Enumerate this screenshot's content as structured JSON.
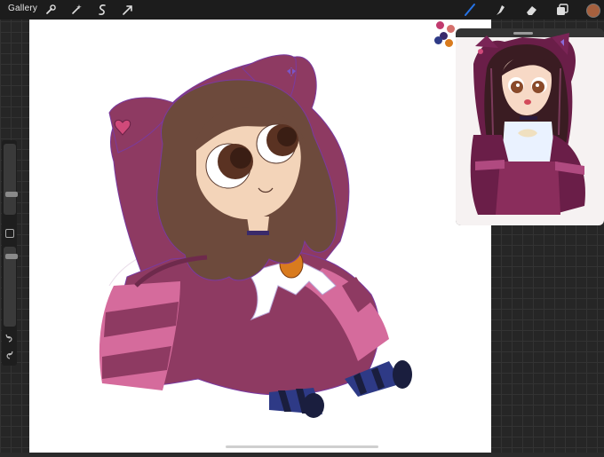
{
  "topbar": {
    "gallery_label": "Gallery",
    "left_tools": [
      "wrench-icon",
      "magic-wand-icon",
      "selection-icon",
      "transform-arrow-icon"
    ],
    "right_tools": [
      "brush-icon",
      "smudge-icon",
      "eraser-icon",
      "layers-icon"
    ],
    "current_color": "#a6603e"
  },
  "sidebar": {
    "brush_size_level": 0.55,
    "opacity_level": 0.65
  },
  "colors": {
    "canvas_bg": "#ffffff",
    "hood": "#8e3a62",
    "hood_dark": "#6e2a4c",
    "hood_stripe": "#d56b9c",
    "hair": "#6d4a3c",
    "skin": "#f3d4b9",
    "sock_blue": "#2e3a86",
    "sock_navy": "#1a1e3e",
    "accent": "#2673e6"
  }
}
